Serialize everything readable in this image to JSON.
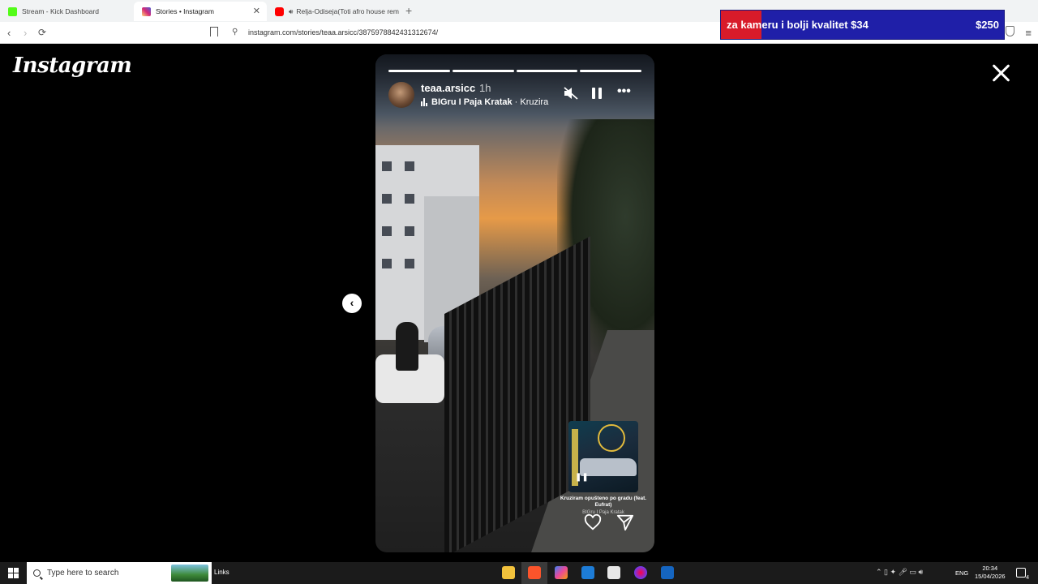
{
  "browser": {
    "tabs": [
      {
        "title": "Stream - Kick Dashboard",
        "favicon_color": "#53fc18",
        "active": false
      },
      {
        "title": "Stories • Instagram",
        "favicon_color": "#e1306c",
        "active": true
      },
      {
        "title": "Relja-Odiseja(Toti afro house rem",
        "favicon_color": "#ff0000",
        "active": false
      }
    ],
    "url": "instagram.com/stories/teaa.arsicc/3875978842431312674/"
  },
  "ad": {
    "text": "za kameru i bolji kvalitet $34",
    "price": "$250"
  },
  "instagram": {
    "logo": "Instagram",
    "story": {
      "username": "teaa.arsicc",
      "time_ago": "1h",
      "music_artist": "BIGru I Paja Kratak",
      "music_song": "· Kruzira",
      "progress": [
        1,
        1,
        1,
        1
      ],
      "sticker_title": "Kruziram opušteno po gradu (feat. Eufrat)",
      "sticker_artist": "BIGru I Paja Kratak"
    },
    "icons": [
      "close-icon",
      "previous-story-icon",
      "mute-icon",
      "pause-icon",
      "more-icon",
      "heart-icon",
      "share-icon"
    ]
  },
  "taskbar": {
    "search_placeholder": "Type here to search",
    "links_label": "Links",
    "language": "ENG",
    "time": "20:34",
    "date": "15/04/2026",
    "notifications": "4"
  }
}
